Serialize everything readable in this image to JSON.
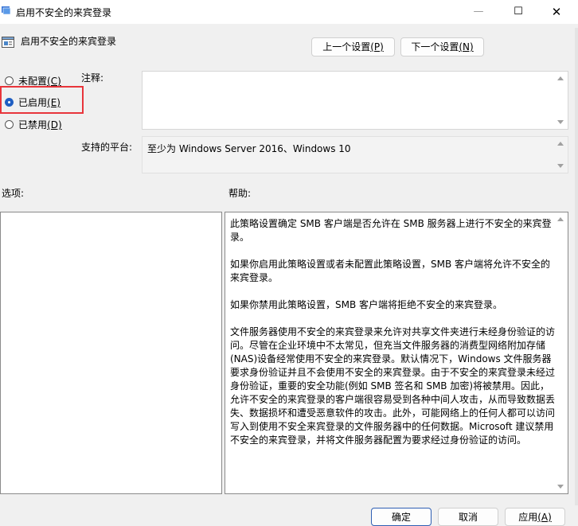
{
  "window": {
    "title": "启用不安全的来宾登录",
    "minimize_glyph": "—",
    "maximize_glyph": "☐",
    "close_glyph": "✕"
  },
  "header": {
    "policy_title": "启用不安全的来宾登录"
  },
  "nav": {
    "prev_label": "上一个设置",
    "prev_key": "(P)",
    "next_label": "下一个设置",
    "next_key": "(N)"
  },
  "radios": [
    {
      "label": "未配置",
      "key": "(C)",
      "checked": false
    },
    {
      "label": "已启用",
      "key": "(E)",
      "checked": true
    },
    {
      "label": "已禁用",
      "key": "(D)",
      "checked": false
    }
  ],
  "comment_label": "注释:",
  "comment_value": "",
  "platform_label": "支持的平台:",
  "platform_value": "至少为 Windows Server 2016、Windows 10",
  "options_label": "选项:",
  "help_label": "帮助:",
  "help_paragraphs": [
    "此策略设置确定 SMB 客户端是否允许在 SMB 服务器上进行不安全的来宾登录。",
    "如果你启用此策略设置或者未配置此策略设置，SMB 客户端将允许不安全的来宾登录。",
    "如果你禁用此策略设置，SMB 客户端将拒绝不安全的来宾登录。",
    "文件服务器使用不安全的来宾登录来允许对共享文件夹进行未经身份验证的访问。尽管在企业环境中不太常见，但充当文件服务器的消费型网络附加存储(NAS)设备经常使用不安全的来宾登录。默认情况下，Windows 文件服务器要求身份验证并且不会使用不安全的来宾登录。由于不安全的来宾登录未经过身份验证，重要的安全功能(例如 SMB 签名和 SMB 加密)将被禁用。因此，允许不安全的来宾登录的客户端很容易受到各种中间人攻击，从而导致数据丢失、数据损坏和遭受恶意软件的攻击。此外，可能网络上的任何人都可以访问写入到使用不安全来宾登录的文件服务器中的任何数据。Microsoft 建议禁用不安全的来宾登录，并将文件服务器配置为要求经过身份验证的访问。"
  ],
  "buttons": {
    "ok": "确定",
    "cancel": "取消",
    "apply": "应用",
    "apply_key": "(A)"
  },
  "colors": {
    "accent": "#1f5ec2",
    "highlight": "#e8353b"
  }
}
